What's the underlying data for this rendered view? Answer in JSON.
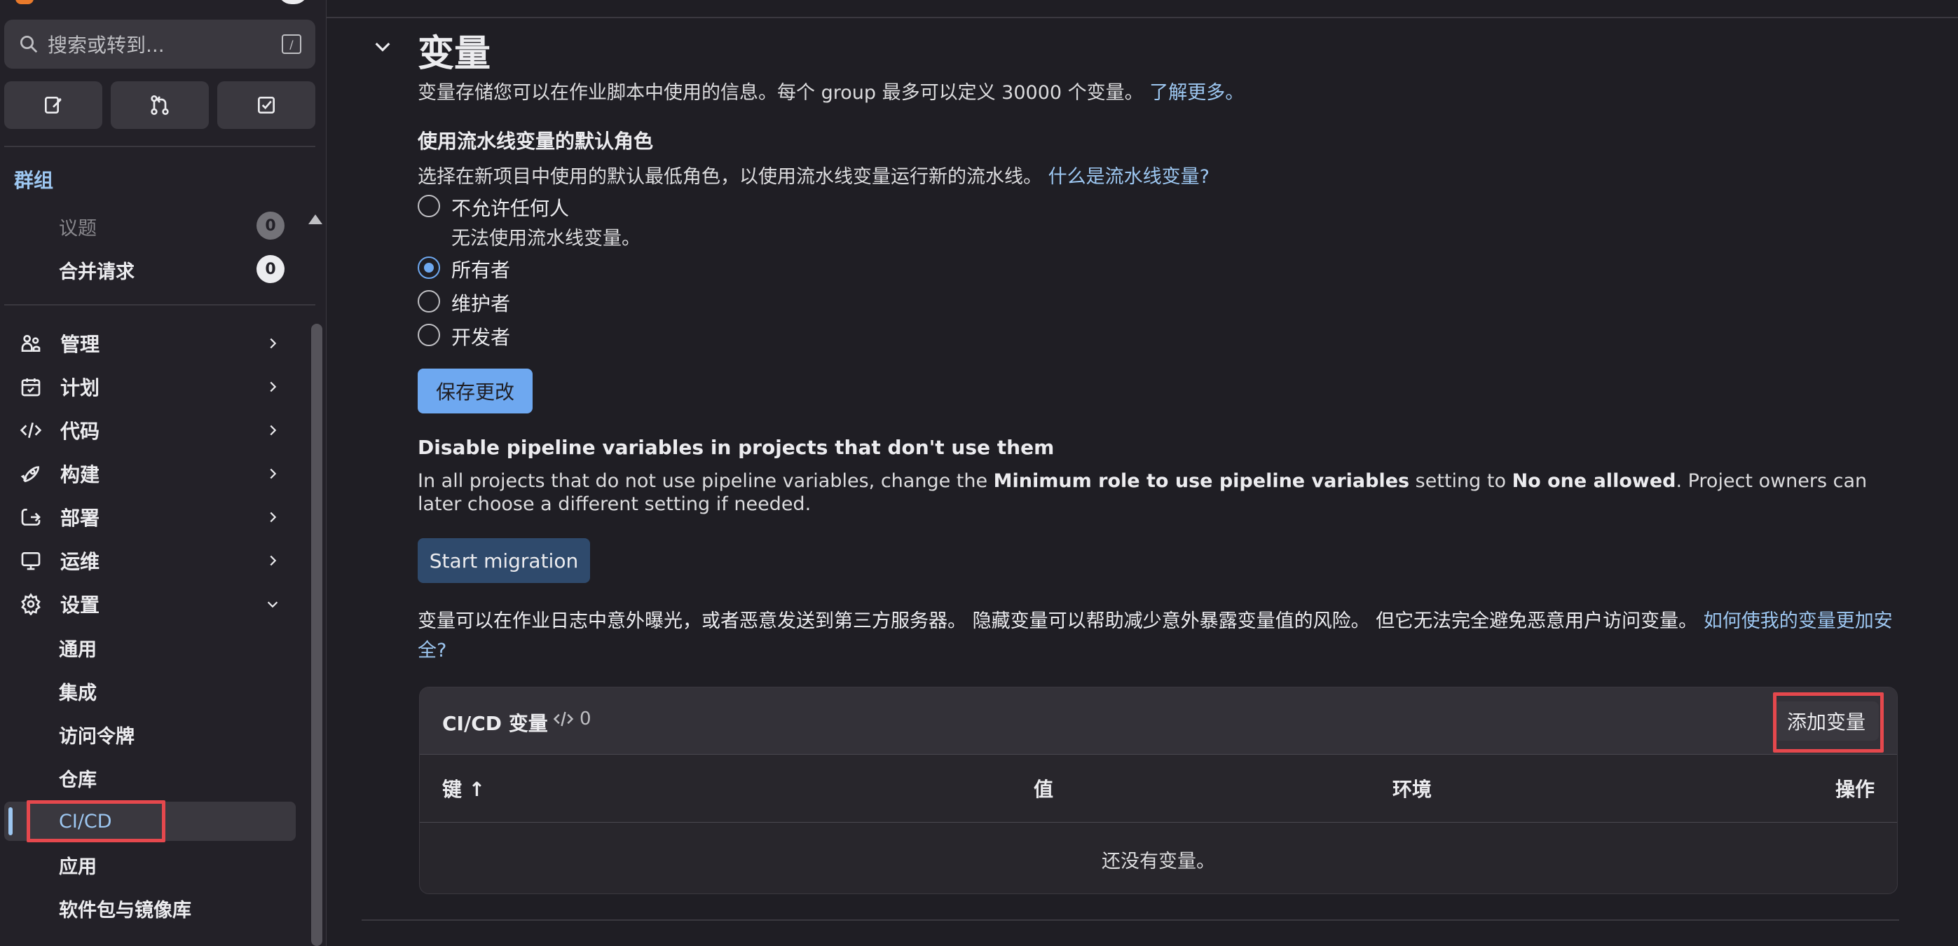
{
  "sidebar": {
    "search_placeholder": "搜索或转到...",
    "search_shortcut": "/",
    "group_title": "群组",
    "sub_items": [
      {
        "label": "议题",
        "count": "0"
      },
      {
        "label": "合并请求",
        "count": "0"
      }
    ],
    "nav": [
      {
        "label": "管理",
        "icon": "users-icon"
      },
      {
        "label": "计划",
        "icon": "calendar-icon"
      },
      {
        "label": "代码",
        "icon": "code-icon"
      },
      {
        "label": "构建",
        "icon": "rocket-icon"
      },
      {
        "label": "部署",
        "icon": "deploy-icon"
      },
      {
        "label": "运维",
        "icon": "monitor-icon"
      },
      {
        "label": "设置",
        "icon": "gear-icon"
      }
    ],
    "settings_items": [
      "通用",
      "集成",
      "访问令牌",
      "仓库",
      "CI/CD",
      "应用",
      "软件包与镜像库"
    ]
  },
  "main": {
    "title": "变量",
    "intro_text": "变量存储您可以在作业脚本中使用的信息。每个 group 最多可以定义 30000 个变量。",
    "intro_link": "了解更多。",
    "default_role_heading": "使用流水线变量的默认角色",
    "default_role_desc": "选择在新项目中使用的默认最低角色，以使用流水线变量运行新的流水线。",
    "default_role_link": "什么是流水线变量?",
    "radio_options": [
      {
        "label": "不允许任何人",
        "help": "无法使用流水线变量。",
        "checked": false
      },
      {
        "label": "所有者",
        "checked": true
      },
      {
        "label": "维护者",
        "checked": false
      },
      {
        "label": "开发者",
        "checked": false
      }
    ],
    "save_button": "保存更改",
    "disable_heading": "Disable pipeline variables in projects that don't use them",
    "disable_desc_1": "In all projects that do not use pipeline variables, change the ",
    "disable_desc_bold_1": "Minimum role to use pipeline variables",
    "disable_desc_2": " setting to ",
    "disable_desc_bold_2": "No one allowed",
    "disable_desc_3": ". Project owners can later choose a different setting if needed.",
    "migration_button": "Start migration",
    "security_text": "变量可以在作业日志中意外曝光，或者恶意发送到第三方服务器。 隐藏变量可以帮助减少意外暴露变量值的风险。 但它无法完全避免恶意用户访问变量。",
    "security_link": "如何使我的变量更加安全?"
  },
  "cicd_card": {
    "title": "CI/CD 变量",
    "count": "0",
    "add_button": "添加变量",
    "columns": [
      "键 ↑",
      "值",
      "环境",
      "操作"
    ],
    "empty_text": "还没有变量。"
  },
  "colors": {
    "accent": "#9dc7f1",
    "primary_button": "#6ea8f0",
    "highlight_box": "#e5484d"
  }
}
